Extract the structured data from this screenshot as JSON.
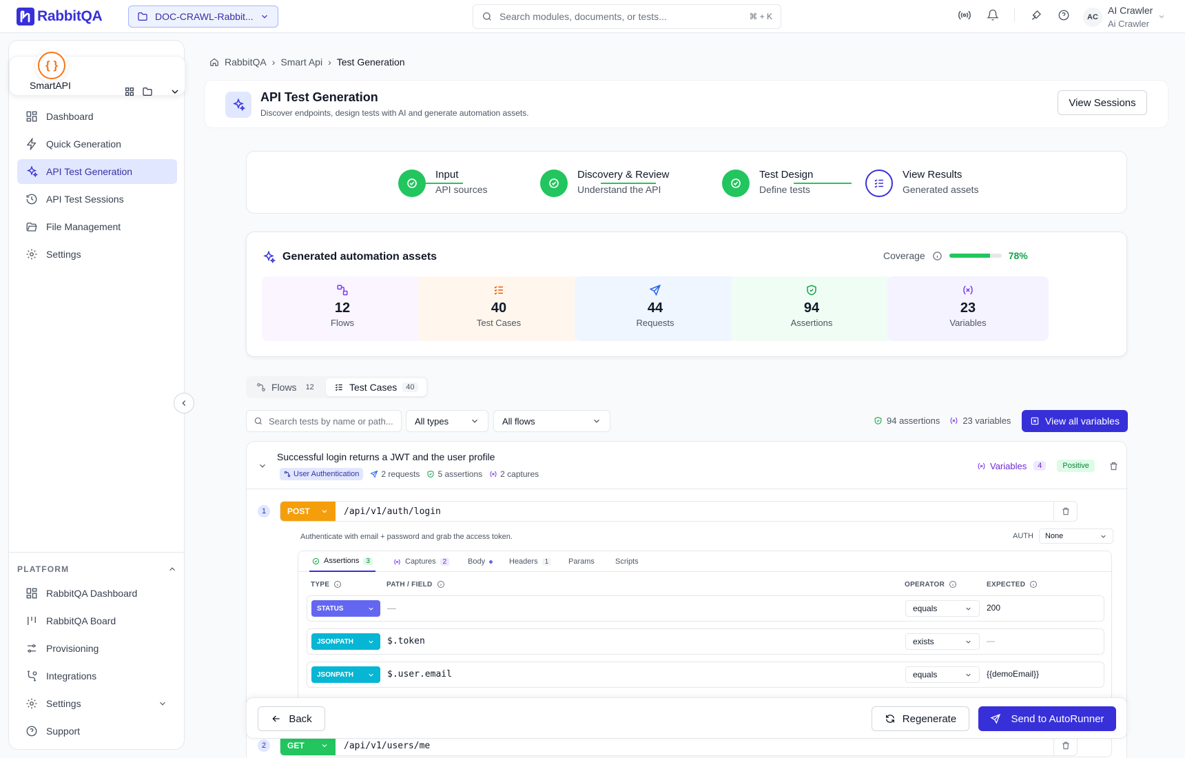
{
  "brand": {
    "name": "RabbitQA",
    "color": "#3730d9"
  },
  "project": {
    "name": "DOC-CRAWL-Rabbit..."
  },
  "search": {
    "placeholder": "Search modules, documents, or tests...",
    "shortcut": "⌘ + K"
  },
  "user": {
    "initials": "AC",
    "name": "AI Crawler",
    "subtitle": "Ai Crawler"
  },
  "app": {
    "name": "SmartAPI",
    "icon": "{ }"
  },
  "nav": {
    "items": [
      {
        "label": "Dashboard",
        "icon": "dashboard-icon"
      },
      {
        "label": "Quick Generation",
        "icon": "bolt-icon"
      },
      {
        "label": "API Test Generation",
        "icon": "sparkles-icon",
        "active": true
      },
      {
        "label": "API Test Sessions",
        "icon": "history-icon"
      },
      {
        "label": "File Management",
        "icon": "folder-icon"
      },
      {
        "label": "Settings",
        "icon": "gear-icon"
      }
    ]
  },
  "platform": {
    "heading": "PLATFORM",
    "items": [
      {
        "label": "RabbitQA Dashboard",
        "icon": "dashboard-icon"
      },
      {
        "label": "RabbitQA Board",
        "icon": "board-icon"
      },
      {
        "label": "Provisioning",
        "icon": "sliders-icon"
      },
      {
        "label": "Integrations",
        "icon": "integrations-icon"
      },
      {
        "label": "Settings",
        "icon": "gear-icon"
      },
      {
        "label": "Support",
        "icon": "help-icon"
      }
    ]
  },
  "breadcrumb": [
    "RabbitQA",
    "Smart Api",
    "Test Generation"
  ],
  "header": {
    "title": "API Test Generation",
    "subtitle": "Discover endpoints, design tests with AI and generate automation assets.",
    "view_sessions": "View Sessions"
  },
  "steps": [
    {
      "title": "Input",
      "sub": "API sources",
      "status": "done"
    },
    {
      "title": "Discovery & Review",
      "sub": "Understand the API",
      "status": "done"
    },
    {
      "title": "Test Design",
      "sub": "Define tests",
      "status": "done"
    },
    {
      "title": "View Results",
      "sub": "Generated assets",
      "status": "current"
    }
  ],
  "assets": {
    "title": "Generated automation assets",
    "coverage_label": "Coverage",
    "coverage_value": "78%",
    "coverage_fraction": 0.78,
    "stats": [
      {
        "value": "12",
        "label": "Flows",
        "bg": "#faf5ff",
        "color": "#7c3aed"
      },
      {
        "value": "40",
        "label": "Test Cases",
        "bg": "#fff7ed",
        "color": "#ea580c"
      },
      {
        "value": "44",
        "label": "Requests",
        "bg": "#eff6ff",
        "color": "#2563eb"
      },
      {
        "value": "94",
        "label": "Assertions",
        "bg": "#f0fdf4",
        "color": "#16a34a"
      },
      {
        "value": "23",
        "label": "Variables",
        "bg": "#f5f3ff",
        "color": "#7c3aed"
      }
    ]
  },
  "tabs": [
    {
      "label": "Flows",
      "count": "12"
    },
    {
      "label": "Test Cases",
      "count": "40",
      "active": true
    }
  ],
  "filters": {
    "search_placeholder": "Search tests by name or path...",
    "type": "All types",
    "flow": "All flows",
    "assertions": "94 assertions",
    "variables": "23 variables",
    "view_all": "View all variables"
  },
  "test_case": {
    "title": "Successful login returns a JWT and the user profile",
    "flow": "User Authentication",
    "requests": "2 requests",
    "assertions": "5 assertions",
    "captures": "2 captures",
    "variables_label": "Variables",
    "variables_count": "4",
    "badge": "Positive",
    "request1": {
      "num": "1",
      "method": "POST",
      "url": "/api/v1/auth/login",
      "description": "Authenticate with email + password and grab the access token.",
      "auth_label": "AUTH",
      "auth_value": "None"
    },
    "request2": {
      "num": "2",
      "method": "GET",
      "url": "/api/v1/users/me"
    },
    "subtabs": [
      {
        "label": "Assertions",
        "count": "3"
      },
      {
        "label": "Captures",
        "count": "2"
      },
      {
        "label": "Body"
      },
      {
        "label": "Headers",
        "count": "1"
      },
      {
        "label": "Params"
      },
      {
        "label": "Scripts"
      }
    ],
    "columns": {
      "type": "TYPE",
      "path": "PATH / FIELD",
      "operator": "OPERATOR",
      "expected": "EXPECTED"
    },
    "rows": [
      {
        "type": "STATUS",
        "path": "—",
        "operator": "equals",
        "expected": "200",
        "color": "#6366f1"
      },
      {
        "type": "JSONPATH",
        "path": "$.token",
        "operator": "exists",
        "expected": "—",
        "color": "#06b6d4"
      },
      {
        "type": "JSONPATH",
        "path": "$.user.email",
        "operator": "equals",
        "expected": "{{demoEmail}}",
        "color": "#06b6d4"
      }
    ]
  },
  "footer": {
    "back": "Back",
    "regenerate": "Regenerate",
    "send": "Send to AutoRunner"
  }
}
